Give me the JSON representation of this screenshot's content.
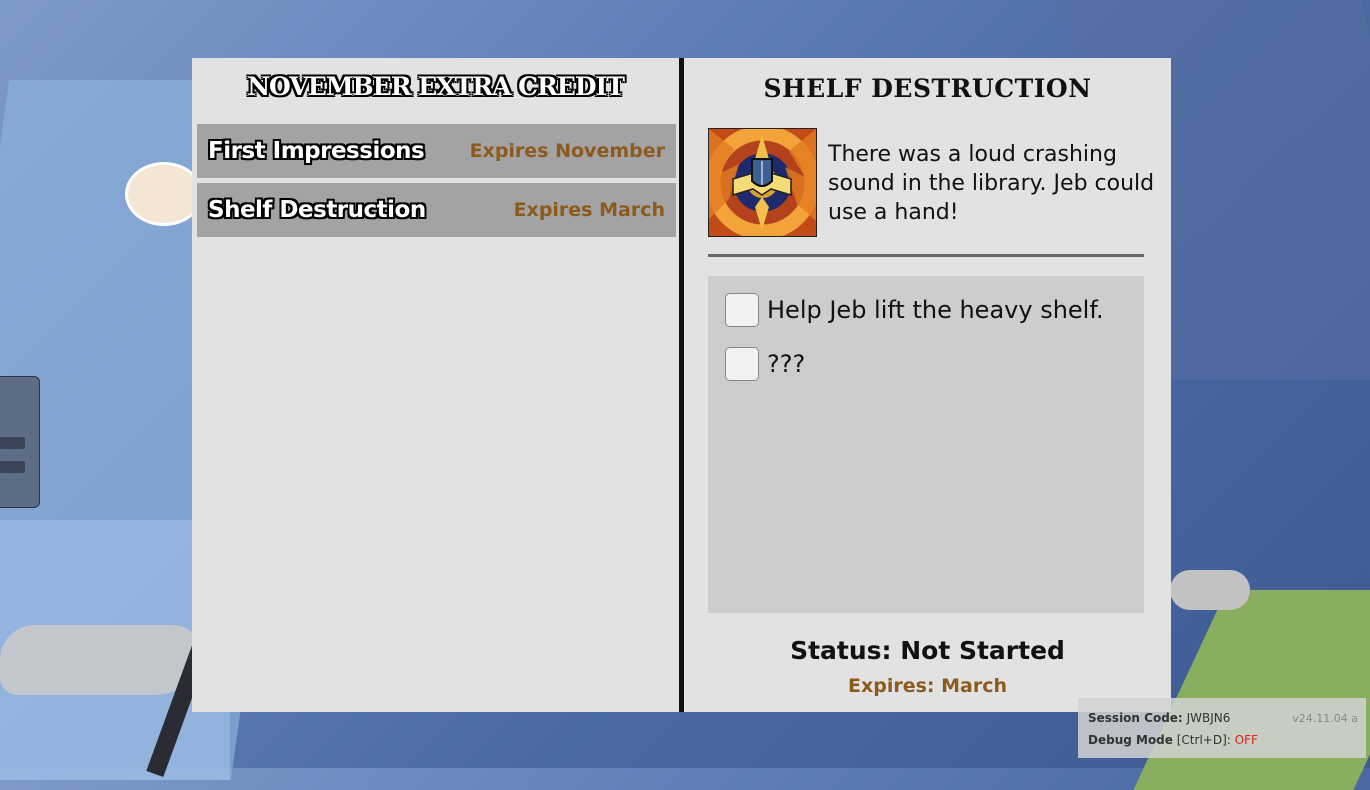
{
  "left_panel": {
    "title": "NOVEMBER EXTRA CREDIT",
    "quests": [
      {
        "name": "First Impressions",
        "expires": "Expires November"
      },
      {
        "name": "Shelf Destruction",
        "expires": "Expires March"
      }
    ]
  },
  "right_panel": {
    "title": "SHELF DESTRUCTION",
    "icon": "stained-glass-book-shield-icon",
    "description": "There was a loud crashing sound in the library. Jeb could use a hand!",
    "tasks": [
      {
        "label": "Help Jeb lift the heavy shelf.",
        "checked": false
      },
      {
        "label": "???",
        "checked": false
      }
    ],
    "status": "Status: Not Started",
    "expires": "Expires: March"
  },
  "debug": {
    "session_label": "Session Code:",
    "session_value": "JWBJN6",
    "version": "v24.11.04 a",
    "debug_label": "Debug Mode",
    "debug_shortcut": "[Ctrl+D]:",
    "debug_value": "OFF"
  },
  "colors": {
    "accent_expires": "#8d5a1e",
    "debug_off": "#e0241b"
  }
}
